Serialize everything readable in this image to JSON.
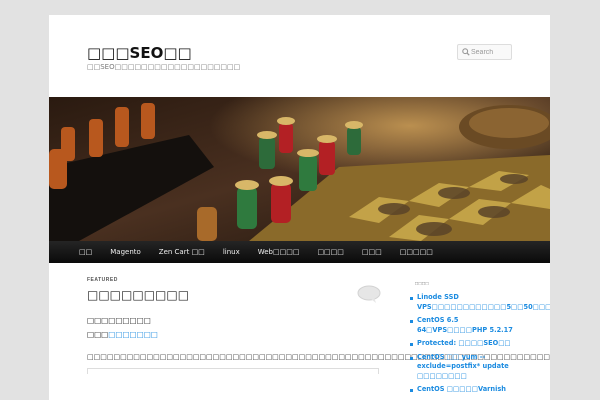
{
  "site": {
    "title": "□□□SEO□□",
    "description": "□□SEO□□□□□□□□□□□□□□□□□□□"
  },
  "search": {
    "placeholder": "Search",
    "icon": "search-icon"
  },
  "nav": {
    "items": [
      {
        "label": "□□"
      },
      {
        "label": "Magento"
      },
      {
        "label": "Zen Cart □□"
      },
      {
        "label": "linux"
      },
      {
        "label": "Web□□□□"
      },
      {
        "label": "□□□□"
      },
      {
        "label": "□□□"
      },
      {
        "label": "□□□□□"
      }
    ]
  },
  "post": {
    "featured_label": "FEATURED",
    "title": "□□□□□□□□□",
    "meta_line1": "□□□□□□□□□",
    "meta_line2_prefix": "□□□",
    "meta_line2_link": "□□□□□□□",
    "body": "□□□□□□□□□□□□□□□□□□□□□□□□□□□□□□□□□□□□□□□□□□□□□□□□□□□□□□□□□□□□□□□□□□□□□□□□□□□□□□□□□□□□□□□□□□□□□□□□□□□□□□□□□□□□□□□□□□□□□□□□□□□□□□□□□□□□□□□□□□□□□□□□□□□□□□□□□□□□□□□"
  },
  "sidebar": {
    "heading": "□□□□",
    "links": [
      {
        "label": "Linode SSD VPS□□□□□□□□□□□□5□□50□□□□□□"
      },
      {
        "label": "CentOS 6.5 64□VPS□□□□PHP 5.2.17"
      },
      {
        "label": "Protected: □□□□SEO□□"
      },
      {
        "label": "CentOS □□ yum --exclude=postfix* update □□□□□□□□"
      },
      {
        "label": "CentOS □□□□□Varnish"
      }
    ]
  },
  "colors": {
    "link": "#1b8be0",
    "nav_bg": "#111111",
    "page_bg": "#e2e2e2"
  }
}
